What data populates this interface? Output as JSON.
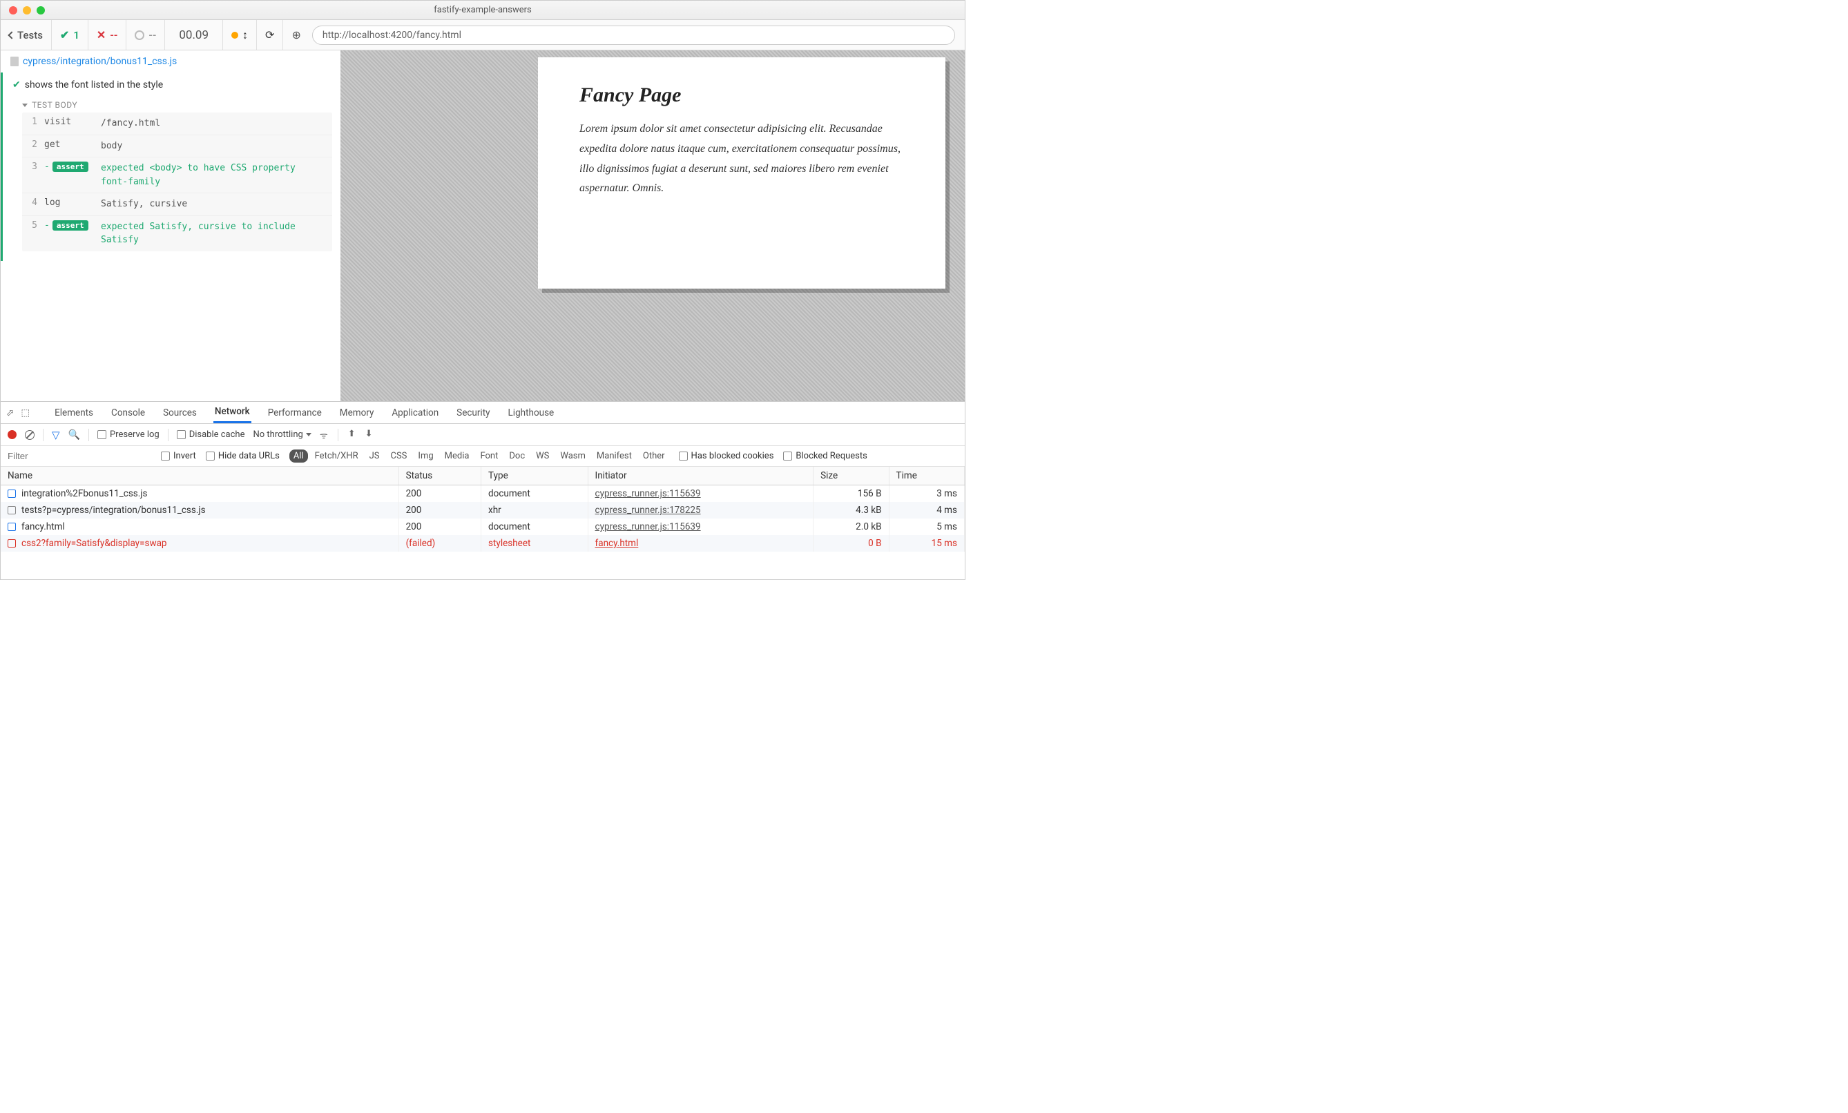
{
  "window": {
    "title": "fastify-example-answers"
  },
  "toolbar": {
    "back_label": "Tests",
    "pass_count": "1",
    "fail_count": "--",
    "pending_count": "--",
    "time": "00.09",
    "url": "http://localhost:4200/fancy.html"
  },
  "spec": {
    "file": "cypress/integration/bonus11_css.js"
  },
  "test": {
    "title": "shows the font listed in the style",
    "body_label": "TEST BODY",
    "commands": [
      {
        "num": "1",
        "name": "visit",
        "msg_plain": "/fancy.html"
      },
      {
        "num": "2",
        "name": "get",
        "msg_plain": "body"
      },
      {
        "num": "3",
        "name": "assert",
        "msg_tokens": [
          {
            "t": "expected",
            "c": "kw"
          },
          {
            "t": " "
          },
          {
            "t": "<body>",
            "c": "val"
          },
          {
            "t": " "
          },
          {
            "t": "to have CSS property",
            "c": "kw"
          },
          {
            "t": " "
          },
          {
            "t": "font-family",
            "c": "val"
          }
        ]
      },
      {
        "num": "4",
        "name": "log",
        "msg_plain": "Satisfy, cursive"
      },
      {
        "num": "5",
        "name": "assert",
        "msg_tokens": [
          {
            "t": "expected",
            "c": "kw"
          },
          {
            "t": " "
          },
          {
            "t": "Satisfy, cursive",
            "c": "val"
          },
          {
            "t": " "
          },
          {
            "t": "to include",
            "c": "kw"
          },
          {
            "t": " "
          },
          {
            "t": "Satisfy",
            "c": "val"
          }
        ]
      }
    ]
  },
  "preview": {
    "heading": "Fancy Page",
    "paragraph": "Lorem ipsum dolor sit amet consectetur adipisicing elit. Recusandae expedita dolore natus itaque cum, exercitationem consequatur possimus, illo dignissimos fugiat a deserunt sunt, sed maiores libero rem eveniet aspernatur. Omnis."
  },
  "devtools": {
    "tabs": [
      "Elements",
      "Console",
      "Sources",
      "Network",
      "Performance",
      "Memory",
      "Application",
      "Security",
      "Lighthouse"
    ],
    "active_tab": "Network",
    "preserve_log": "Preserve log",
    "disable_cache": "Disable cache",
    "throttling": "No throttling",
    "filter_placeholder": "Filter",
    "invert": "Invert",
    "hide_urls": "Hide data URLs",
    "type_filters": [
      "All",
      "Fetch/XHR",
      "JS",
      "CSS",
      "Img",
      "Media",
      "Font",
      "Doc",
      "WS",
      "Wasm",
      "Manifest",
      "Other"
    ],
    "active_type": "All",
    "blocked_cookies": "Has blocked cookies",
    "blocked_requests": "Blocked Requests",
    "columns": [
      "Name",
      "Status",
      "Type",
      "Initiator",
      "Size",
      "Time"
    ],
    "rows": [
      {
        "icon": "doc",
        "name": "integration%2Fbonus11_css.js",
        "status": "200",
        "type": "document",
        "initiator": "cypress_runner.js:115639",
        "size": "156 B",
        "time": "3 ms",
        "failed": false
      },
      {
        "icon": "other",
        "name": "tests?p=cypress/integration/bonus11_css.js",
        "status": "200",
        "type": "xhr",
        "initiator": "cypress_runner.js:178225",
        "size": "4.3 kB",
        "time": "4 ms",
        "failed": false
      },
      {
        "icon": "doc",
        "name": "fancy.html",
        "status": "200",
        "type": "document",
        "initiator": "cypress_runner.js:115639",
        "size": "2.0 kB",
        "time": "5 ms",
        "failed": false
      },
      {
        "icon": "fail",
        "name": "css2?family=Satisfy&display=swap",
        "status": "(failed)",
        "type": "stylesheet",
        "initiator": "fancy.html",
        "size": "0 B",
        "time": "15 ms",
        "failed": true
      }
    ]
  }
}
